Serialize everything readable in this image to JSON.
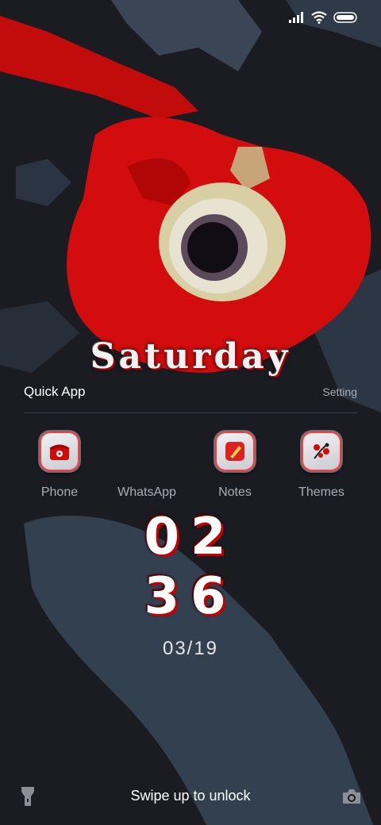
{
  "day": "Saturday",
  "quick_apps": {
    "title": "Quick App",
    "setting": "Setting",
    "apps": [
      {
        "label": "Phone",
        "icon": "phone-icon"
      },
      {
        "label": "WhatsApp",
        "icon": "whatsapp-icon"
      },
      {
        "label": "Notes",
        "icon": "notes-icon"
      },
      {
        "label": "Themes",
        "icon": "themes-icon"
      }
    ]
  },
  "clock": {
    "hour": "02",
    "minute": "36"
  },
  "date": "03/19",
  "unlock_hint": "Swipe up to unlock",
  "icons": {
    "status": [
      "signal-icon",
      "wifi-icon",
      "battery-icon"
    ],
    "bottom_left": "flashlight-icon",
    "bottom_right": "camera-icon"
  },
  "colors": {
    "accent": "#d40a0a",
    "background": "#1a1c22",
    "secondary_text": "#a9adb5"
  }
}
